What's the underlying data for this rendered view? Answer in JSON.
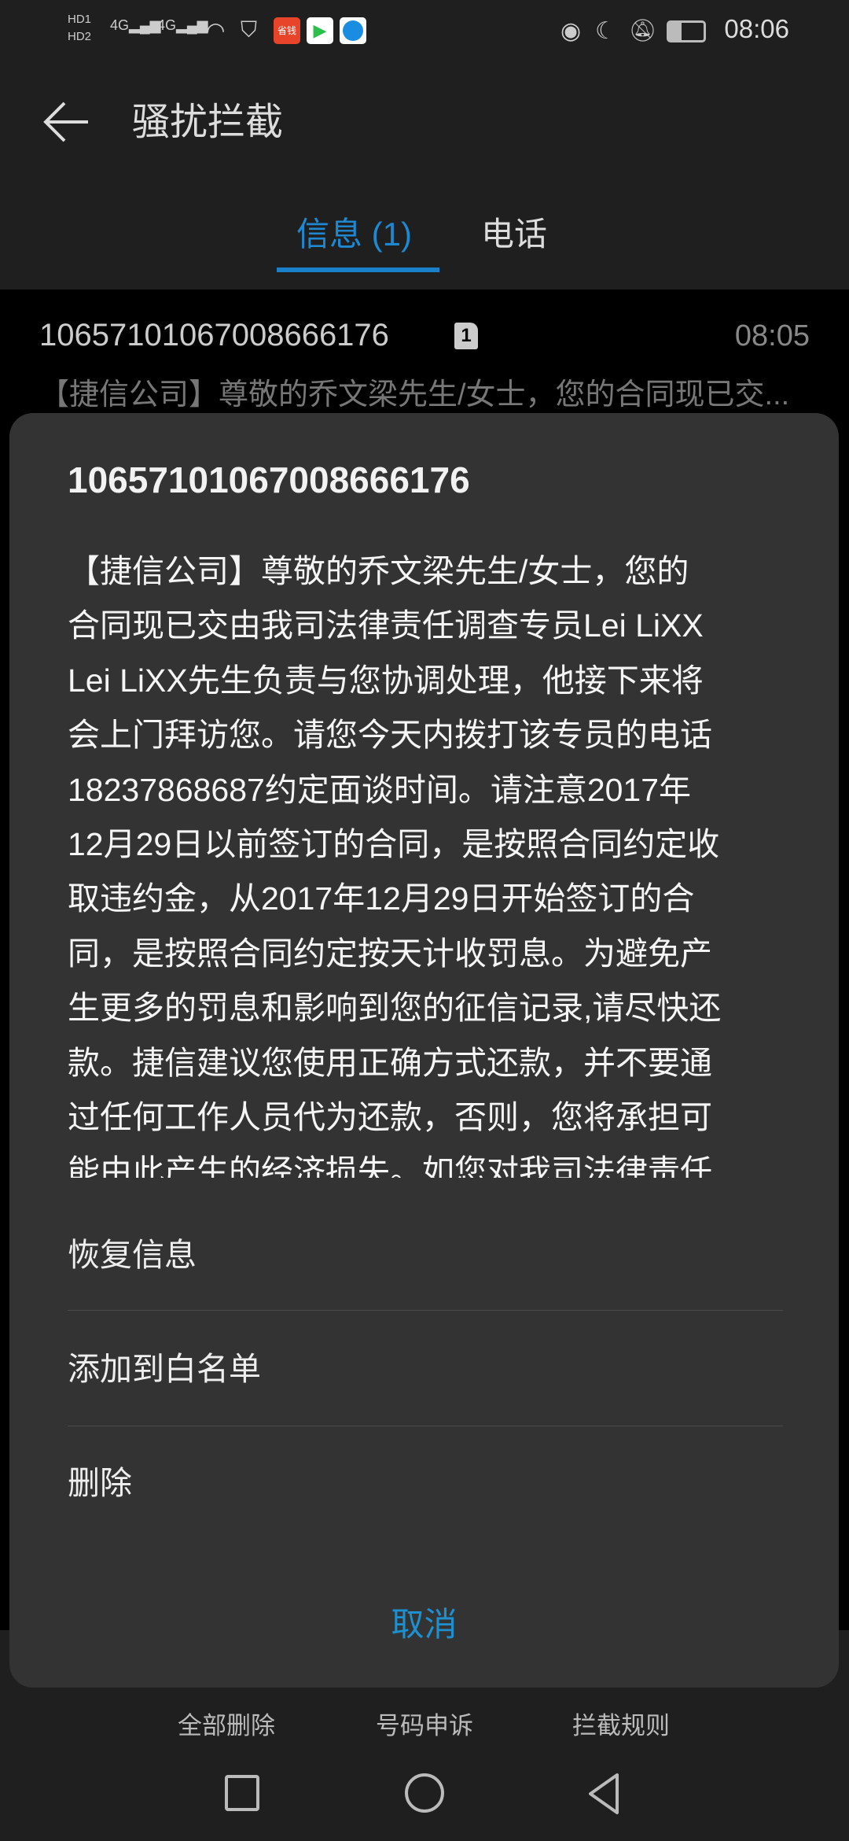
{
  "status_bar": {
    "time": "08:06",
    "left_icons": [
      "hd1-icon",
      "hd2-icon",
      "signal-4g-1-icon",
      "signal-4g-2-icon",
      "wifi-icon",
      "shield-icon",
      "app-shengqian-icon",
      "app-video-icon",
      "app-browser-icon"
    ],
    "right_icons": [
      "eye-icon",
      "moon-icon",
      "bell-off-icon",
      "battery-icon"
    ],
    "app_badge_text": "省钱"
  },
  "header": {
    "title": "骚扰拦截"
  },
  "tabs": [
    {
      "label": "信息 (1)",
      "active": true
    },
    {
      "label": "电话",
      "active": false
    }
  ],
  "message_row": {
    "number": "10657101067008666176",
    "sim": "1",
    "time": "08:05",
    "preview": "【捷信公司】尊敬的乔文梁先生/女士，您的合同现已交..."
  },
  "dialog": {
    "title": "10657101067008666176",
    "body_lines": [
      "【捷信公司】尊敬的乔文梁先生/女士，您的",
      "合同现已交由我司法律责任调查专员Lei LiXX",
      "Lei LiXX先生负责与您协调处理，他接下来将",
      "会上门拜访您。请您今天内拨打该专员的电话",
      "18237868687约定面谈时间。请注意2017年",
      "12月29日以前签订的合同，是按照合同约定收",
      "取违约金，从2017年12月29日开始签订的合",
      "同，是按照合同约定按天计收罚息。为避免产",
      "生更多的罚息和影响到您的征信记录,请尽快还",
      "款。捷信建议您使用正确方式还款，并不要通",
      "过任何工作人员代为还款，否则，您将承担可",
      "能由此产生的经济损失。如您对我司法律责任"
    ],
    "actions": [
      "恢复信息",
      "添加到白名单",
      "删除"
    ],
    "cancel": "取消"
  },
  "toolbar": [
    "全部删除",
    "号码申诉",
    "拦截规则"
  ],
  "colors": {
    "accent": "#1e88d0",
    "dialog_bg": "#333333",
    "list_bg": "#000000",
    "header_bg": "#1f1f1f"
  }
}
